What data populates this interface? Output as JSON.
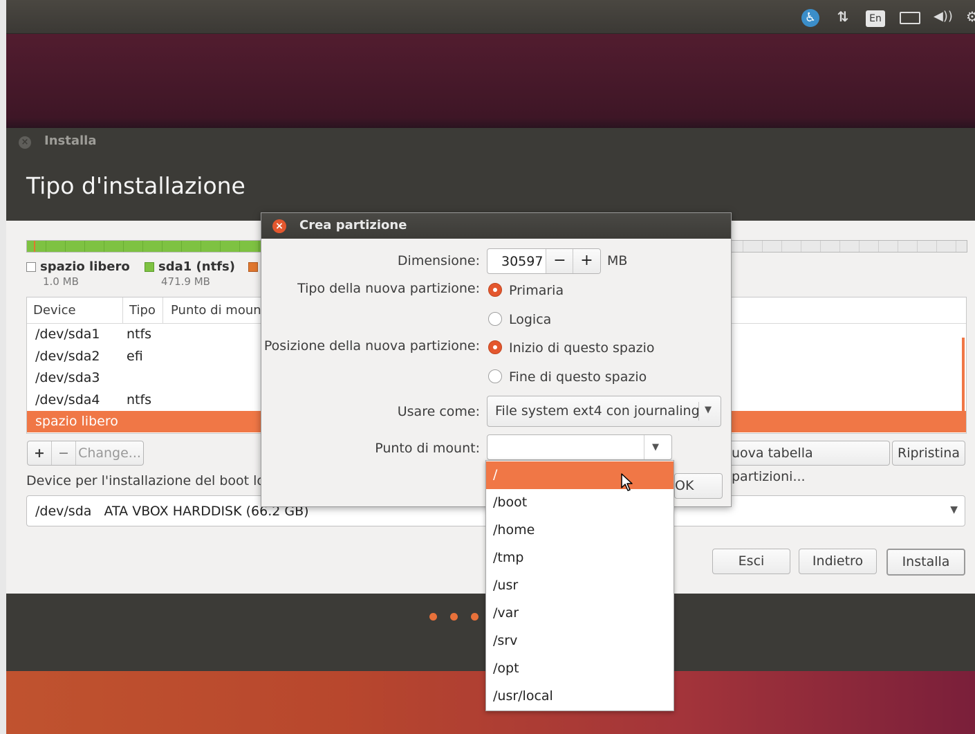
{
  "topbar": {
    "accessibility_icon": "accessibility-icon",
    "network_icon": "network-arrows-icon",
    "keyboard_layout": "En",
    "battery_icon": "battery-icon",
    "volume_icon": "volume-icon",
    "settings_icon": "gear-icon"
  },
  "window": {
    "title": "Installa",
    "heading": "Tipo d'installazione"
  },
  "legend": [
    {
      "name": "spazio libero",
      "size": "1.0 MB",
      "color": "#ffffff"
    },
    {
      "name": "sda1 (ntfs)",
      "size": "471.9 MB",
      "color": "#7ec242"
    },
    {
      "name": "",
      "size": "",
      "color": "#e0772f"
    }
  ],
  "table": {
    "headers": [
      "Device",
      "Tipo",
      "Punto di moun"
    ],
    "rows": [
      {
        "device": "/dev/sda1",
        "type": "ntfs"
      },
      {
        "device": "/dev/sda2",
        "type": "efi"
      },
      {
        "device": "/dev/sda3",
        "type": ""
      },
      {
        "device": "/dev/sda4",
        "type": "ntfs"
      },
      {
        "device": "spazio libero",
        "type": ""
      }
    ],
    "selected_index": 4
  },
  "partition_buttons": {
    "add": "+",
    "remove": "−",
    "change": "Change...",
    "new_table": "uova tabella partizioni...",
    "revert": "Ripristina"
  },
  "boot": {
    "label": "Device per l'installazione del boot loa",
    "value": "/dev/sda   ATA VBOX HARDDISK (66.2 GB)"
  },
  "nav": {
    "quit": "Esci",
    "back": "Indietro",
    "install": "Installa"
  },
  "dialog": {
    "title": "Crea partizione",
    "size_label": "Dimensione:",
    "size_value": "30597",
    "size_minus": "−",
    "size_plus": "+",
    "size_unit": "MB",
    "type_label": "Tipo della nuova partizione:",
    "type_primary": "Primaria",
    "type_logical": "Logica",
    "position_label": "Posizione della nuova partizione:",
    "position_start": "Inizio di questo spazio",
    "position_end": "Fine di questo spazio",
    "use_as_label": "Usare come:",
    "use_as_value": "File system ext4 con journaling",
    "mount_label": "Punto di mount:",
    "mount_value": "",
    "ok": "OK"
  },
  "mount_options": [
    "/",
    "/boot",
    "/home",
    "/tmp",
    "/usr",
    "/var",
    "/srv",
    "/opt",
    "/usr/local"
  ],
  "mount_selected_index": 0
}
